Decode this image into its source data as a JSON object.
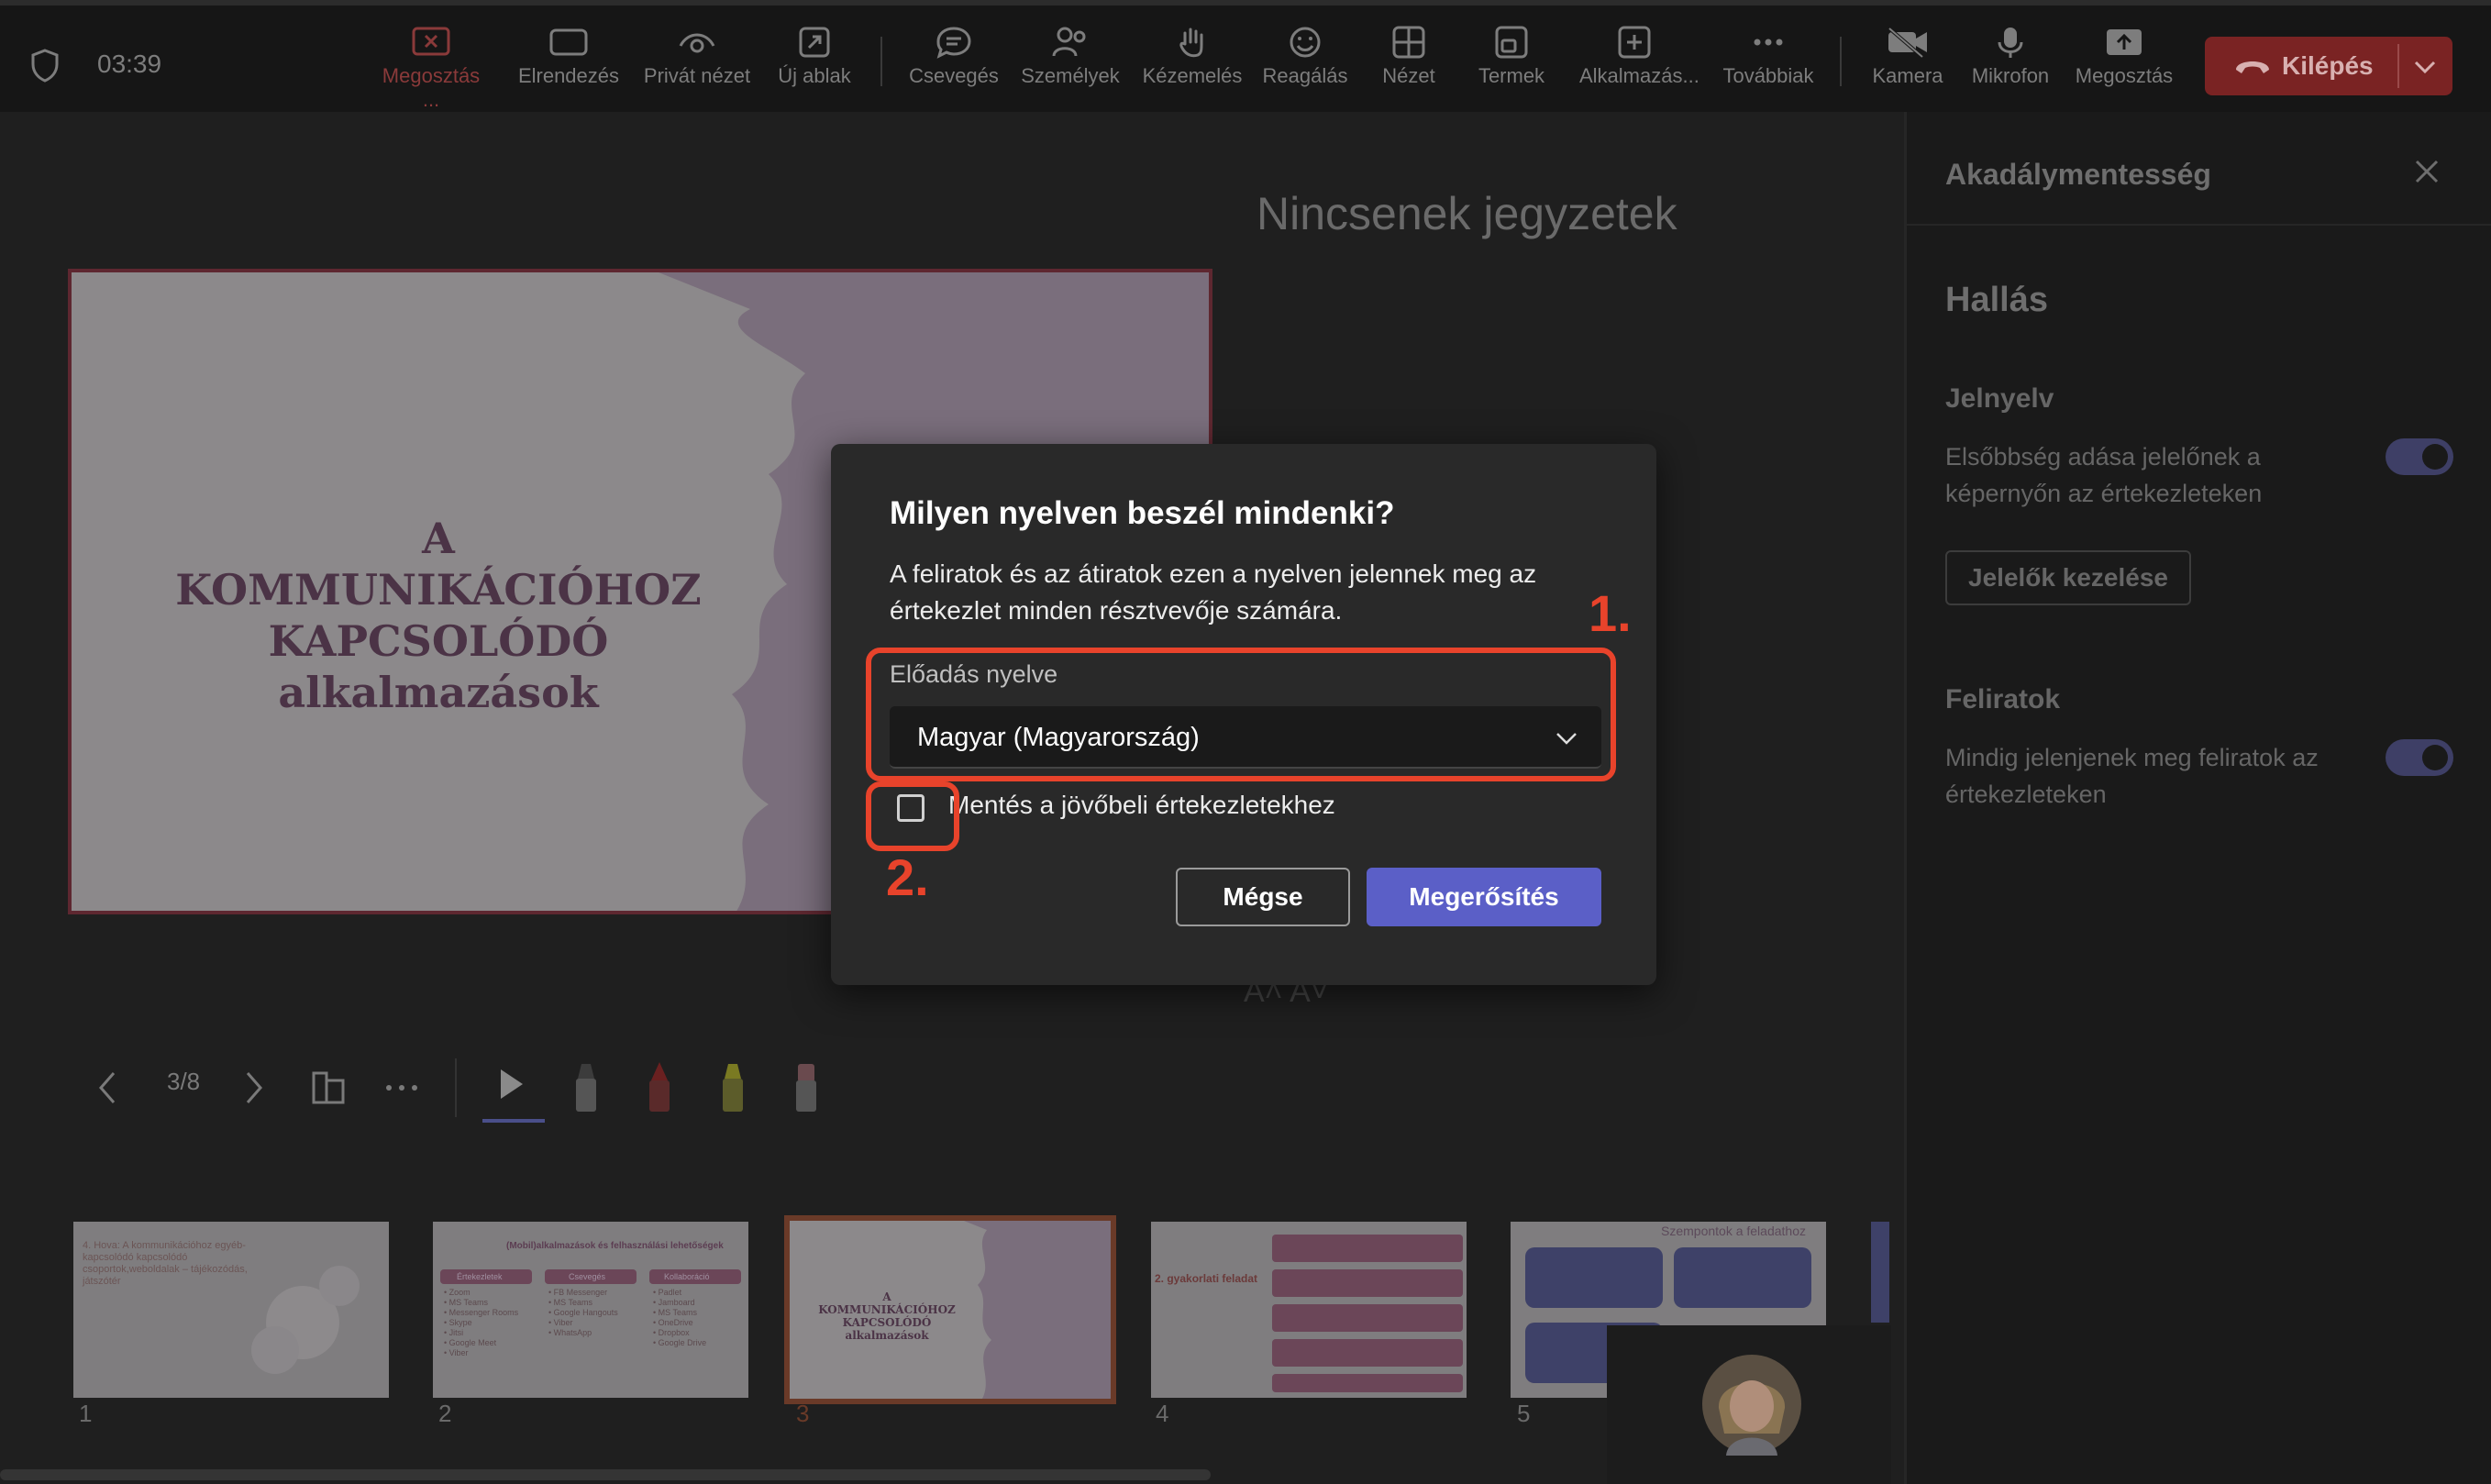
{
  "toolbar": {
    "timer": "03:39",
    "items": [
      {
        "label": "Megosztás ...",
        "icon": "stop-sharing-icon"
      },
      {
        "label": "Elrendezés",
        "icon": "layout-icon"
      },
      {
        "label": "Privát nézet",
        "icon": "private-view-icon"
      },
      {
        "label": "Új ablak",
        "icon": "new-window-icon"
      },
      {
        "label": "Csevegés",
        "icon": "chat-icon"
      },
      {
        "label": "Személyek",
        "icon": "people-icon"
      },
      {
        "label": "Kézemelés",
        "icon": "raise-hand-icon"
      },
      {
        "label": "Reagálás",
        "icon": "react-icon"
      },
      {
        "label": "Nézet",
        "icon": "view-icon"
      },
      {
        "label": "Termek",
        "icon": "rooms-icon"
      },
      {
        "label": "Alkalmazás...",
        "icon": "apps-icon"
      },
      {
        "label": "Továbbiak",
        "icon": "more-icon"
      },
      {
        "label": "Kamera",
        "icon": "camera-off-icon"
      },
      {
        "label": "Mikrofon",
        "icon": "microphone-icon"
      },
      {
        "label": "Megosztás",
        "icon": "share-icon"
      }
    ],
    "leave_label": "Kilépés"
  },
  "stage": {
    "slide_title_lines": [
      "A",
      "KOMMUNIKÁCIÓHOZ",
      "KAPCSOLÓDÓ",
      "alkalmazások"
    ],
    "notes_title": "Nincsenek jegyzetek",
    "font_controls": "A˄ A˅",
    "page_indicator": "3/8"
  },
  "thumbnails": {
    "numbers": [
      "1",
      "2",
      "3",
      "4",
      "5"
    ],
    "t1_text": "4. Hova: A kommunikációhoz egyéb­kapcsolódó kapcsolódó csoportok,weboldalak – tájékozódás, játszótér",
    "t2_title": "(Mobil)alkalmazások és felhasználási lehetőségek",
    "t2_cols": [
      "Értekezletek",
      "Csevegés",
      "Kollaboráció"
    ],
    "t2_col1": [
      "• Zoom",
      "• MS Teams",
      "• Messenger Rooms",
      "• Skype",
      "• Jitsi",
      "• Google Meet",
      "• Viber"
    ],
    "t2_col2": [
      "• FB Messenger",
      "• MS Teams",
      "• Google Hangouts",
      "• Viber",
      "• WhatsApp"
    ],
    "t2_col3": [
      "• Padlet",
      "• Jamboard",
      "• MS Teams",
      "• OneDrive",
      "• Dropbox",
      "• Google Drive"
    ],
    "t3_title_lines": [
      "A",
      "KOMMUNIKÁCIÓHOZ",
      "KAPCSOLÓDÓ",
      "alkalmazások"
    ],
    "t4_title": "2. gyakorlati feladat",
    "t5_title": "Szempontok a feladathoz"
  },
  "panel": {
    "title": "Akadálymentesség",
    "section": "Hallás",
    "sign_title": "Jelnyelv",
    "sign_desc": "Elsőbbség adása jelelőnek a képernyőn az értekezleteken",
    "manage_button": "Jelelők kezelése",
    "captions_title": "Feliratok",
    "captions_desc": "Mindig jelenjenek meg feliratok az értekezleteken"
  },
  "dialog": {
    "title": "Milyen nyelven beszél mindenki?",
    "description": "A feliratok és az átiratok ezen a nyelven jelennek meg az értekezlet minden résztvevője számára.",
    "dropdown_label": "Előadás nyelve",
    "dropdown_value": "Magyar (Magyarország)",
    "checkbox_label": "Mentés a jövőbeli értekezletekhez",
    "cancel": "Mégse",
    "confirm": "Megerősítés"
  },
  "annotations": {
    "one": "1.",
    "two": "2."
  },
  "colors": {
    "accent": "#5b5fc7",
    "annotation": "#e8432b",
    "leave": "#7a2323"
  }
}
